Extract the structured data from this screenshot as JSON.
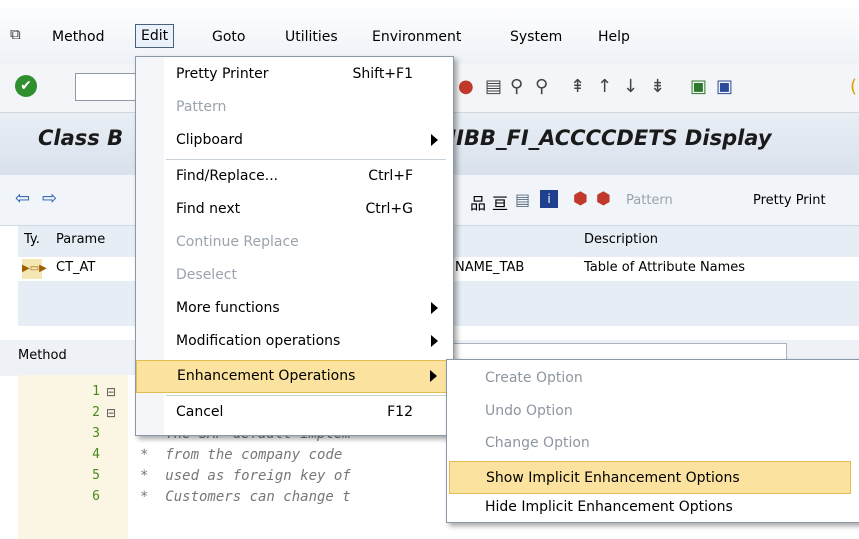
{
  "menubar": {
    "items": [
      "Method",
      "Edit",
      "Goto",
      "Utilities",
      "Environment",
      "System",
      "Help"
    ],
    "active": "Edit"
  },
  "title": {
    "visible_left": "Class B",
    "visible_right": "UIBB_FI_ACCCCDETS Display"
  },
  "app_toolbar": {
    "pattern_label": "Pattern",
    "pretty_printer_label": "Pretty Print"
  },
  "params": {
    "headers": [
      "Ty.",
      "Parame",
      "Description"
    ],
    "row": {
      "name": "CT_AT",
      "type": "NAME_TAB",
      "description": "Table of Attribute Names"
    }
  },
  "method": {
    "label": "Method"
  },
  "editor": {
    "lines": [
      {
        "n": "1",
        "text": ""
      },
      {
        "n": "2",
        "text": ""
      },
      {
        "n": "3",
        "text": "*  The SAP default implem"
      },
      {
        "n": "4",
        "text": "*  from the company code"
      },
      {
        "n": "5",
        "text": "*  used as foreign key of"
      },
      {
        "n": "6",
        "text": "*  Customers can change t"
      }
    ]
  },
  "edit_menu": {
    "items": [
      {
        "label": "Pretty Printer",
        "shortcut": "Shift+F1",
        "disabled": false,
        "submenu": false
      },
      {
        "label": "Pattern",
        "shortcut": "",
        "disabled": true,
        "submenu": false
      },
      {
        "label": "Clipboard",
        "shortcut": "",
        "disabled": false,
        "submenu": true
      },
      {
        "label": "Find/Replace...",
        "shortcut": "Ctrl+F",
        "disabled": false,
        "submenu": false
      },
      {
        "label": "Find next",
        "shortcut": "Ctrl+G",
        "disabled": false,
        "submenu": false
      },
      {
        "label": "Continue Replace",
        "shortcut": "",
        "disabled": true,
        "submenu": false
      },
      {
        "label": "Deselect",
        "shortcut": "",
        "disabled": true,
        "submenu": false
      },
      {
        "label": "More functions",
        "shortcut": "",
        "disabled": false,
        "submenu": true
      },
      {
        "label": "Modification operations",
        "shortcut": "",
        "disabled": false,
        "submenu": true
      },
      {
        "label": "Enhancement Operations",
        "shortcut": "",
        "disabled": false,
        "submenu": true,
        "highlighted": true
      },
      {
        "label": "Cancel",
        "shortcut": "F12",
        "disabled": false,
        "submenu": false
      }
    ]
  },
  "enh_submenu": {
    "items": [
      {
        "label": "Create Option",
        "disabled": true
      },
      {
        "label": "Undo Option",
        "disabled": true
      },
      {
        "label": "Change Option",
        "disabled": true
      },
      {
        "label": "Show Implicit Enhancement Options",
        "disabled": false,
        "highlighted": true
      },
      {
        "label": "Hide Implicit Enhancement Options",
        "disabled": false
      }
    ]
  },
  "colors": {
    "highlight": "#fbe39f",
    "highlight_border": "#e3bd4f",
    "menu_border": "#8a99aa"
  }
}
